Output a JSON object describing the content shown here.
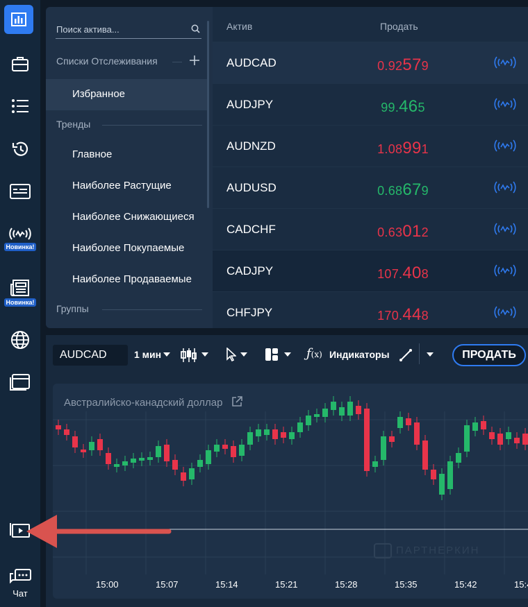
{
  "sidebar": {
    "items": [
      {
        "icon": "chart-icon",
        "active": true
      },
      {
        "icon": "briefcase-icon"
      },
      {
        "icon": "list-icon"
      },
      {
        "icon": "history-icon"
      },
      {
        "icon": "payment-card-icon"
      },
      {
        "icon": "signals-icon",
        "badge": "Новинка!"
      },
      {
        "icon": "news-icon",
        "badge": "Новинка!"
      },
      {
        "icon": "globe-icon"
      },
      {
        "icon": "window-icon"
      },
      {
        "icon": "video-icon"
      },
      {
        "icon": "chat-icon",
        "label": "Чат"
      }
    ]
  },
  "watchlist": {
    "search_placeholder": "Поиск актива...",
    "watchlists_header": "Списки Отслеживания",
    "favorites": "Избранное",
    "trends_header": "Тренды",
    "trend_items": [
      "Главное",
      "Наиболее Растущие",
      "Наиболее Снижающиеся",
      "Наиболее Покупаемые",
      "Наиболее Продаваемые"
    ],
    "groups_header": "Группы"
  },
  "assets": {
    "col_asset": "Актив",
    "col_sell": "Продать",
    "rows": [
      {
        "name": "AUDCAD",
        "p1": "0.92",
        "p2": "57",
        "p3": "9",
        "dir": "red"
      },
      {
        "name": "AUDJPY",
        "p1": "99.",
        "p2": "46",
        "p3": "5",
        "dir": "green"
      },
      {
        "name": "AUDNZD",
        "p1": "1.08",
        "p2": "99",
        "p3": "1",
        "dir": "red"
      },
      {
        "name": "AUDUSD",
        "p1": "0.68",
        "p2": "67",
        "p3": "9",
        "dir": "green"
      },
      {
        "name": "CADCHF",
        "p1": "0.63",
        "p2": "01",
        "p3": "2",
        "dir": "red"
      },
      {
        "name": "CADJPY",
        "p1": "107.",
        "p2": "40",
        "p3": "8",
        "dir": "red"
      },
      {
        "name": "CHFJPY",
        "p1": "170.",
        "p2": "44",
        "p3": "8",
        "dir": "red"
      }
    ]
  },
  "toolbar": {
    "asset": "AUDCAD",
    "timeframe": "1 мин",
    "indicators": "Индикаторы",
    "sell_button": "ПРОДАТЬ"
  },
  "chart": {
    "title": "Австралийско-канадский доллар",
    "watermark": "ПАРТНЕРКИН",
    "x_labels": [
      "15:00",
      "15:07",
      "15:14",
      "15:21",
      "15:28",
      "15:35",
      "15:42",
      "15:4"
    ]
  },
  "colors": {
    "up": "#25b86a",
    "down": "#e8344a",
    "accent": "#2f7bf1",
    "annotation": "#d9534f"
  }
}
